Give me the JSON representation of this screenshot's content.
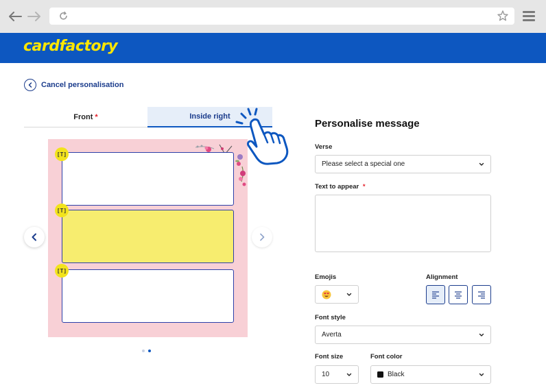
{
  "brand": {
    "logo_text": "cardfactory",
    "primary_color": "#0d57c0",
    "accent_color": "#ffe600"
  },
  "browser": {
    "icons": [
      "back-arrow-icon",
      "forward-arrow-icon",
      "reload-icon",
      "star-icon",
      "hamburger-menu-icon"
    ]
  },
  "nav": {
    "cancel_label": "Cancel personalisation"
  },
  "tabs": [
    {
      "label": "Front",
      "required": "*"
    },
    {
      "label": "Inside right",
      "active": true
    }
  ],
  "preview": {
    "text_badge": "[T]",
    "text_boxes": 3,
    "highlighted_box": 2,
    "pagination": {
      "pages": 2,
      "current": 2
    }
  },
  "form": {
    "title": "Personalise message",
    "verse": {
      "label": "Verse",
      "value": "Please select a special one"
    },
    "text_to_appear": {
      "label": "Text to appear",
      "required": "*",
      "value": ""
    },
    "emojis": {
      "label": "Emojis",
      "value_icon": "heart-eyes-emoji-icon"
    },
    "alignment": {
      "label": "Alignment",
      "options": [
        "left",
        "center",
        "right"
      ],
      "selected": "left"
    },
    "font_style": {
      "label": "Font style",
      "value": "Averta"
    },
    "font_size": {
      "label": "Font size",
      "value": "10"
    },
    "font_color": {
      "label": "Font color",
      "value": "Black",
      "swatch": "#111111"
    }
  }
}
